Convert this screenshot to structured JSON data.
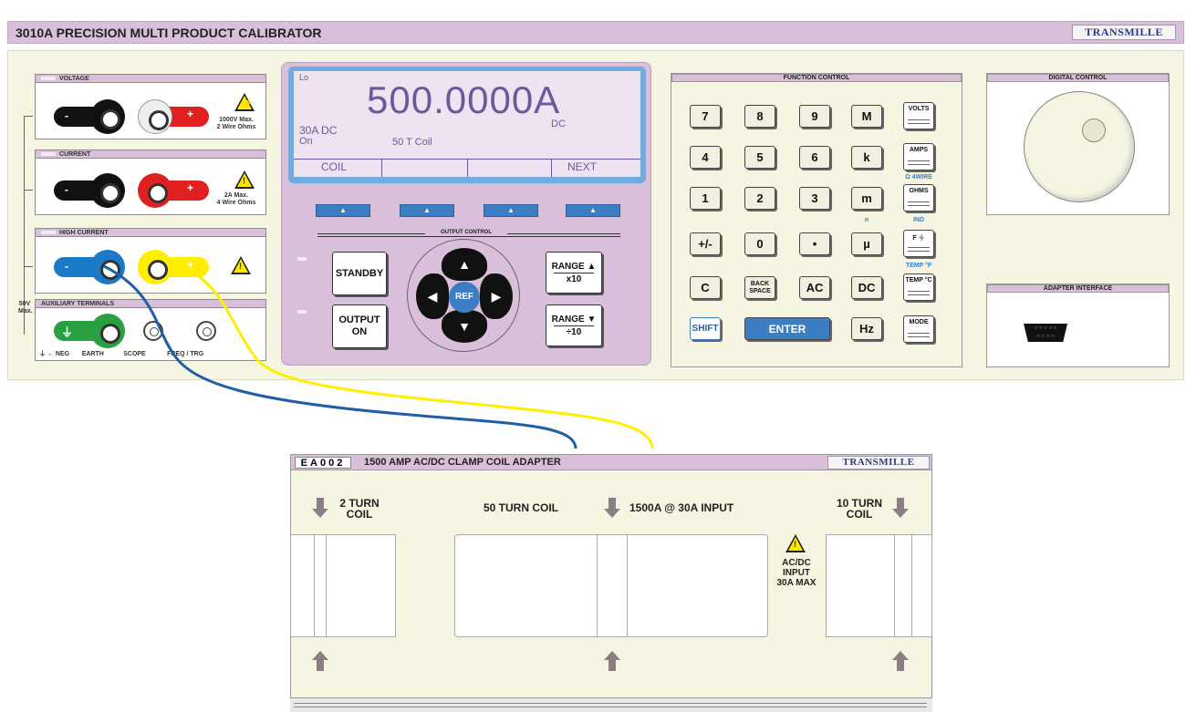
{
  "title": "3010A PRECISION MULTI PRODUCT CALIBRATOR",
  "brand": "TRANSMILLE",
  "terminals": {
    "voltage": {
      "header": "VOLTAGE",
      "neg": "-",
      "pos": "+",
      "rating_line1": "1000V Max.",
      "rating_line2": "2 Wire Ohms"
    },
    "current": {
      "header": "CURRENT",
      "neg": "-",
      "pos": "+",
      "rating_line1": "2A Max.",
      "rating_line2": "4 Wire Ohms"
    },
    "high_current": {
      "header": "HIGH CURRENT",
      "neg": "-",
      "pos": "+"
    },
    "auxiliary": {
      "header": "AUXILIARY TERMINALS",
      "footer_neg": "NEG",
      "footer_earth": "EARTH",
      "footer_scope": "SCOPE",
      "footer_freq": "FREQ / TRG"
    },
    "side_label_1": "50V",
    "side_label_2": "Max."
  },
  "display": {
    "lo": "Lo",
    "value": "500.0000A",
    "unit_suffix": "DC",
    "range": "30A DC",
    "state": "On",
    "mode": "50  T  Coil",
    "softkeys": [
      "COIL",
      "",
      "",
      "NEXT"
    ]
  },
  "output_control": {
    "header": "OUTPUT CONTROL",
    "standby": "STANDBY",
    "output_on_1": "OUTPUT",
    "output_on_2": "ON",
    "ref": "REF",
    "range_up_1": "RANGE ▲",
    "range_up_2": "x10",
    "range_down_1": "RANGE ▼",
    "range_down_2": "÷10"
  },
  "function_control": {
    "header": "FUNCTION CONTROL",
    "keys": [
      "7",
      "8",
      "9",
      "M",
      "4",
      "5",
      "6",
      "k",
      "1",
      "2",
      "3",
      "m",
      "+/-",
      "0",
      "•",
      "µ",
      "C",
      "BACK SPACE",
      "AC",
      "DC"
    ],
    "shift": "SHIFT",
    "enter": "ENTER",
    "hz": "Hz",
    "volts": "VOLTS",
    "amps": "AMPS",
    "ohms": "OHMS",
    "farad": "F ⏆",
    "temp_c": "TEMP °C",
    "mode": "MODE",
    "label_4wire": "Ω 4WIRE",
    "label_ind": "IND",
    "label_n": "n",
    "label_tempf": "TEMP °F"
  },
  "digital_control": {
    "header": "DIGITAL CONTROL"
  },
  "adapter_interface": {
    "header": "ADAPTER INTERFACE"
  },
  "adapter": {
    "code": "EA002",
    "title": "1500 AMP AC/DC CLAMP COIL ADAPTER",
    "two_turn_1": "2 TURN",
    "two_turn_2": "COIL",
    "fifty_turn": "50 TURN COIL",
    "rating": "1500A @ 30A INPUT",
    "ten_turn_1": "10 TURN",
    "ten_turn_2": "COIL",
    "input_1": "AC/DC",
    "input_2": "INPUT",
    "input_3": "30A MAX"
  },
  "colors": {
    "panel_purple": "#d9bfd9",
    "chassis": "#f6f5e1",
    "accent_blue": "#3c7ec4",
    "lead_blue": "#1f5fa8",
    "lead_yellow": "#ffee00"
  }
}
